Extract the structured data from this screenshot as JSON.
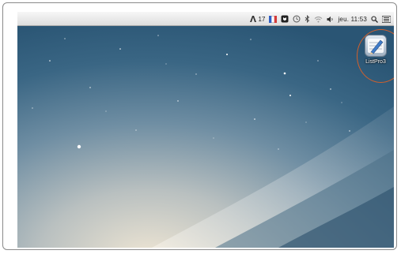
{
  "menubar": {
    "extras": [
      {
        "icon": "adobe-updater-icon",
        "label": "17"
      },
      {
        "icon": "input-source-flag-icon",
        "label": ""
      },
      {
        "icon": "dropbox-icon",
        "label": ""
      },
      {
        "icon": "time-machine-icon",
        "label": ""
      },
      {
        "icon": "bluetooth-icon",
        "label": ""
      },
      {
        "icon": "wifi-icon",
        "label": ""
      },
      {
        "icon": "volume-icon",
        "label": ""
      }
    ],
    "clock": "jeu. 11:53",
    "spotlight_icon": "spotlight-search-icon",
    "notification_icon": "notification-center-icon"
  },
  "desktop": {
    "icons": [
      {
        "label": "ListPro3",
        "icon": "listpro-app-icon"
      }
    ]
  },
  "colors": {
    "highlight_ring": "#d2602c",
    "menubar_bg": "#ececec",
    "wallpaper_top": "#2b5a79",
    "wallpaper_glow": "#d9d3c4"
  }
}
